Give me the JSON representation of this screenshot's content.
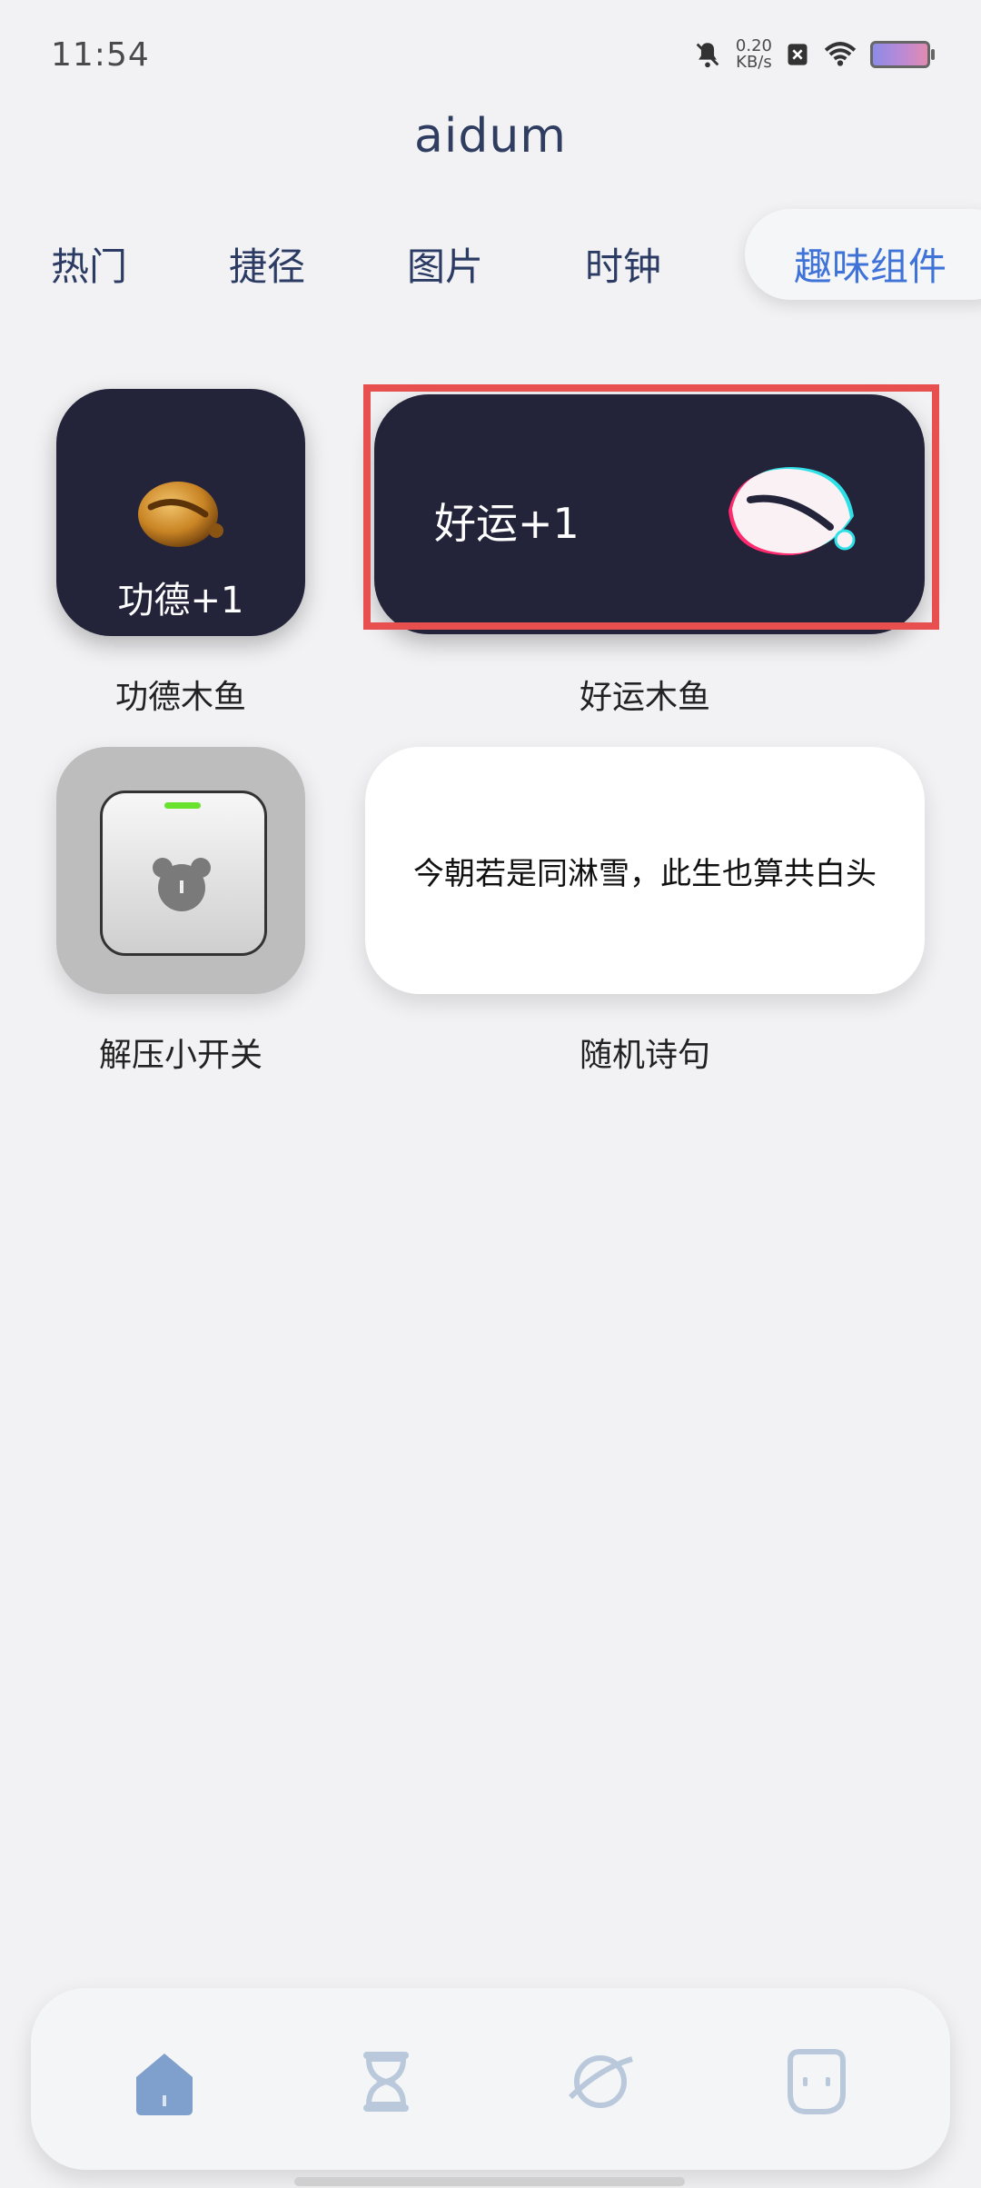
{
  "status_bar": {
    "time": "11:54",
    "network_speed_value": "0.20",
    "network_speed_unit": "KB/s"
  },
  "app": {
    "title": "aidum"
  },
  "tabs": [
    {
      "label": "热门"
    },
    {
      "label": "捷径"
    },
    {
      "label": "图片"
    },
    {
      "label": "时钟"
    },
    {
      "label": "趣味组件",
      "active": true
    }
  ],
  "widgets": {
    "merit_fish": {
      "tile_text": "功德+1",
      "caption": "功德木鱼"
    },
    "luck_fish": {
      "tile_text": "好运+1",
      "caption": "好运木鱼"
    },
    "switch": {
      "caption": "解压小开关"
    },
    "poem": {
      "text": "今朝若是同淋雪，此生也算共白头",
      "caption": "随机诗句"
    }
  },
  "bottom_nav": [
    {
      "icon": "home-icon"
    },
    {
      "icon": "hourglass-icon"
    },
    {
      "icon": "planet-icon"
    },
    {
      "icon": "ghost-face-icon"
    }
  ],
  "colors": {
    "accent": "#3f73d8",
    "tile_dark": "#23233a",
    "highlight": "#e84f4f",
    "switch_led": "#69e22e"
  }
}
